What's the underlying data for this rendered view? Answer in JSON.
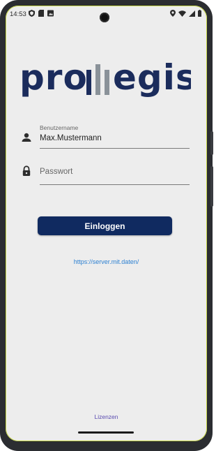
{
  "status_bar": {
    "time": "14:53",
    "left_icons": [
      "shield-icon",
      "sim-card-icon",
      "media-icon"
    ],
    "right_icons": [
      "location-icon",
      "wifi-icon",
      "signal-icon",
      "battery-icon"
    ]
  },
  "logo": {
    "text": "promegis",
    "color": "#1b2c5c",
    "accent_color": "#8a9299"
  },
  "form": {
    "username": {
      "label": "Benutzername",
      "value": "Max.Mustermann",
      "icon": "person-icon"
    },
    "password": {
      "placeholder": "Passwort",
      "icon": "lock-icon"
    },
    "login_button_label": "Einloggen",
    "server_url": "https://server.mit.daten/"
  },
  "footer": {
    "license_label": "Lizenzen"
  },
  "colors": {
    "primary": "#102a60",
    "link": "#2b7fd1",
    "license_link": "#5a4bb0",
    "background": "#ededed"
  }
}
